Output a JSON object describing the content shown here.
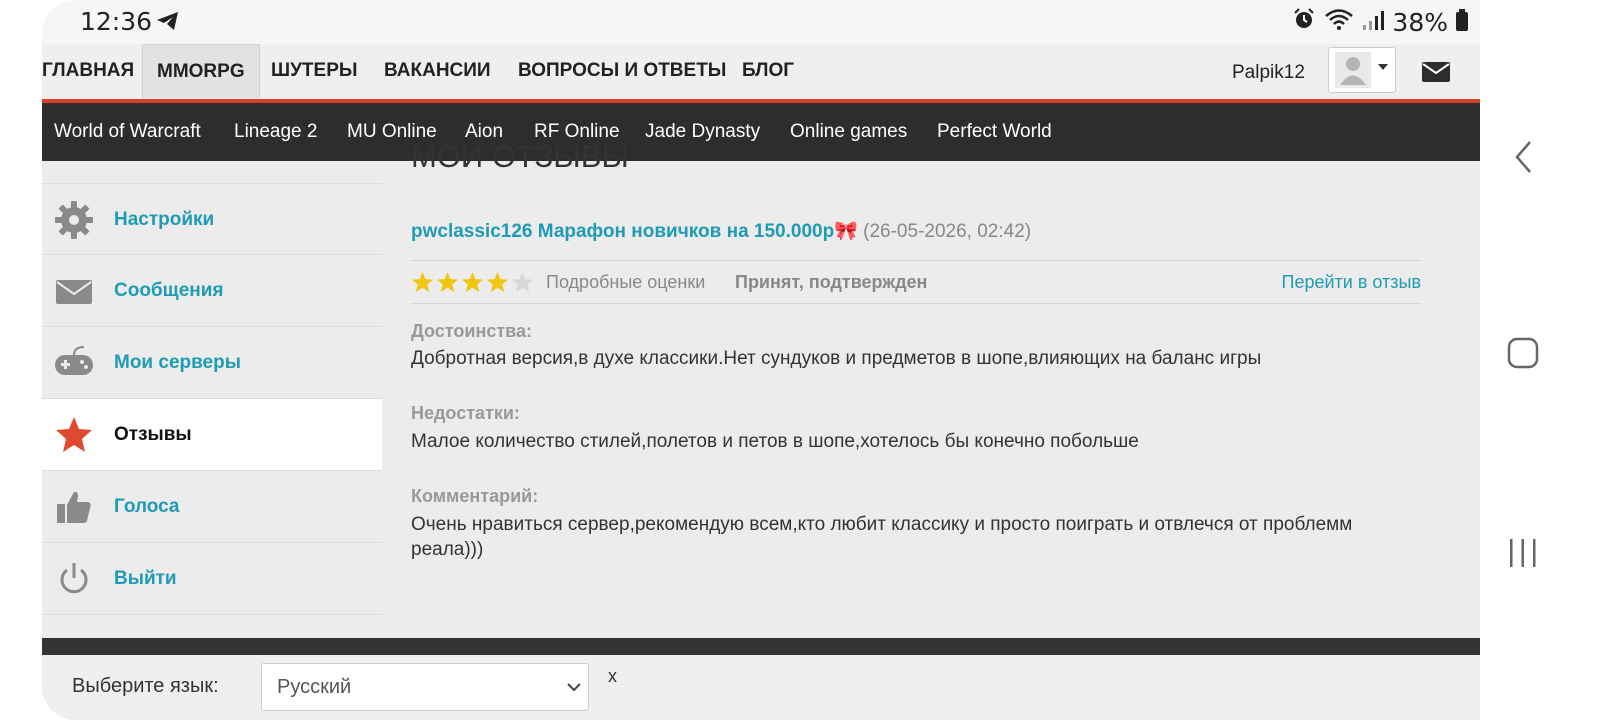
{
  "status_bar": {
    "time": "12:36",
    "battery": "38%"
  },
  "top_menu": {
    "items": [
      "ГЛАВНАЯ",
      "MMORPG",
      "ШУТЕРЫ",
      "ВАКАНСИИ",
      "ВОПРОСЫ И ОТВЕТЫ",
      "БЛОГ"
    ],
    "active": "MMORPG",
    "username": "Palpik12"
  },
  "categories": [
    "World of Warcraft",
    "Lineage 2",
    "MU Online",
    "Aion",
    "RF Online",
    "Jade Dynasty",
    "Online games",
    "Perfect World"
  ],
  "sidebar": {
    "items": [
      {
        "label": "Настройки",
        "icon": "gear-icon"
      },
      {
        "label": "Сообщения",
        "icon": "envelope-icon"
      },
      {
        "label": "Мои серверы",
        "icon": "gamepad-icon"
      },
      {
        "label": "Отзывы",
        "icon": "star-icon"
      },
      {
        "label": "Голоса",
        "icon": "thumbs-up-icon"
      },
      {
        "label": "Выйти",
        "icon": "power-icon"
      }
    ],
    "active": "Отзывы"
  },
  "main": {
    "page_title": "Мои отзывы",
    "review": {
      "title": "pwclassic126 Марафон новичков на 150.000р🎀",
      "date": "(26-05-2026, 02:42)",
      "stars": 4,
      "stars_max": 5,
      "rating_details": "Подробные оценки",
      "status": "Принят, подтвержден",
      "goto": "Перейти в отзыв",
      "pros_label": "Достоинства:",
      "pros": "Добротная версия,в духе классики.Нет сундуков и предметов в шопе,влияющих на баланс игры",
      "cons_label": "Недостатки:",
      "cons": "Малое количество стилей,полетов и петов в шопе,хотелось бы конечно побольше",
      "comment_label": "Комментарий:",
      "comment": "Очень нравиться сервер,рекомендую всем,кто любит классику и просто поиграть и отвлечся от проблемм реала)))"
    }
  },
  "language": {
    "label": "Выберите язык:",
    "selected": "Русский",
    "close": "x"
  },
  "colors": {
    "accent": "#1f9bb6",
    "red_line": "#d9402a",
    "dark_bar": "#2d2d2d",
    "star": "#f2c511"
  }
}
